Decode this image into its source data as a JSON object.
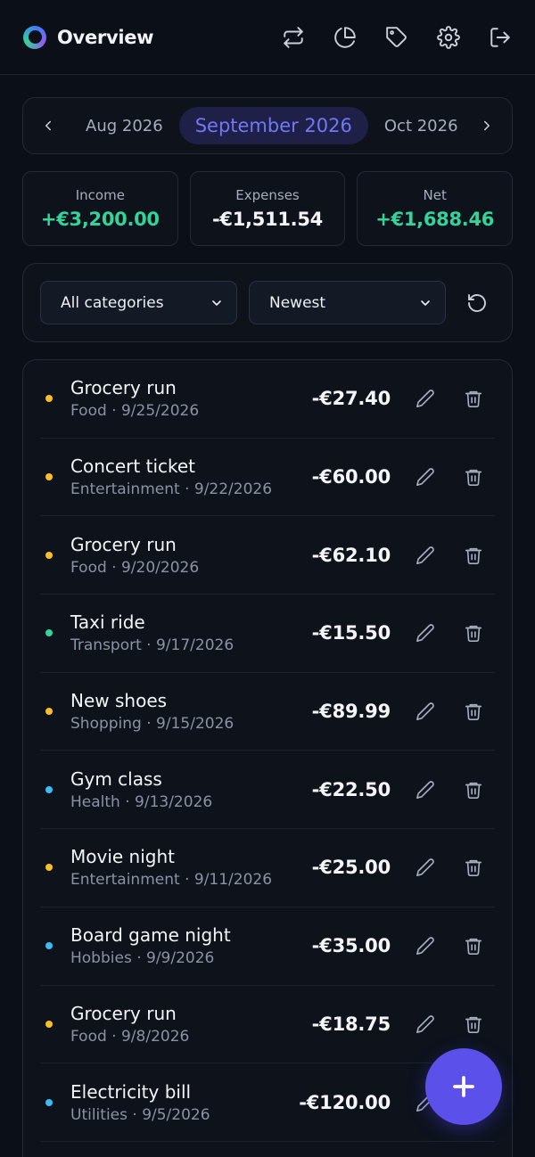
{
  "header": {
    "title": "Overview",
    "icons": [
      "transfer-icon",
      "pie-chart-icon",
      "tag-icon",
      "gear-icon",
      "logout-icon"
    ]
  },
  "month_nav": {
    "prev": "Aug 2026",
    "current": "September 2026",
    "next": "Oct 2026"
  },
  "summary": {
    "income_label": "Income",
    "income_value": "+€3,200.00",
    "expenses_label": "Expenses",
    "expenses_value": "-€1,511.54",
    "net_label": "Net",
    "net_value": "+€1,688.46"
  },
  "filters": {
    "category": "All categories",
    "sort": "Newest"
  },
  "colors": {
    "accent": "#5b50ea",
    "positive": "#34d399",
    "food": "#fbbf24",
    "entertainment": "#fbbf24",
    "shopping": "#fbbf24",
    "transport": "#34d399",
    "health": "#38bdf8",
    "hobbies": "#38bdf8",
    "utilities": "#38bdf8"
  },
  "transactions": [
    {
      "title": "Grocery run",
      "meta": "Food · 9/25/2026",
      "amount": "-€27.40",
      "dot": "#fbbf24"
    },
    {
      "title": "Concert ticket",
      "meta": "Entertainment · 9/22/2026",
      "amount": "-€60.00",
      "dot": "#fbbf24"
    },
    {
      "title": "Grocery run",
      "meta": "Food · 9/20/2026",
      "amount": "-€62.10",
      "dot": "#fbbf24"
    },
    {
      "title": "Taxi ride",
      "meta": "Transport · 9/17/2026",
      "amount": "-€15.50",
      "dot": "#34d399"
    },
    {
      "title": "New shoes",
      "meta": "Shopping · 9/15/2026",
      "amount": "-€89.99",
      "dot": "#fbbf24"
    },
    {
      "title": "Gym class",
      "meta": "Health · 9/13/2026",
      "amount": "-€22.50",
      "dot": "#38bdf8"
    },
    {
      "title": "Movie night",
      "meta": "Entertainment · 9/11/2026",
      "amount": "-€25.00",
      "dot": "#fbbf24"
    },
    {
      "title": "Board game night",
      "meta": "Hobbies · 9/9/2026",
      "amount": "-€35.00",
      "dot": "#38bdf8"
    },
    {
      "title": "Grocery run",
      "meta": "Food · 9/8/2026",
      "amount": "-€18.75",
      "dot": "#fbbf24"
    },
    {
      "title": "Electricity bill",
      "meta": "Utilities · 9/5/2026",
      "amount": "-€120.00",
      "dot": "#38bdf8"
    }
  ]
}
